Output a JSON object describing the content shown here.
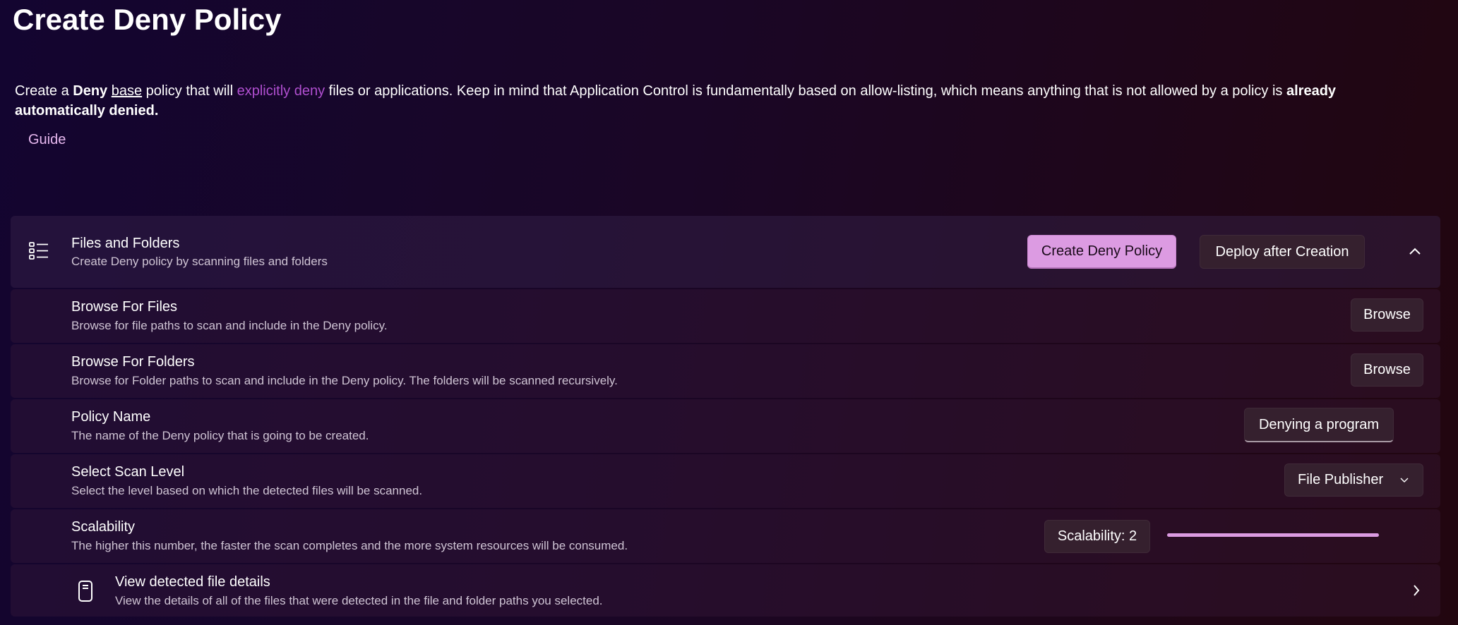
{
  "page": {
    "title": "Create Deny Policy",
    "intro": {
      "p1": "Create a ",
      "deny": "Deny",
      "p2": " ",
      "base": "base",
      "p3": " policy that will ",
      "explicit": "explicitly deny",
      "p4": " files or applications. Keep in mind that Application Control is fundamentally based on allow-listing, which means anything that is not allowed by a policy is ",
      "already": "already automatically denied."
    },
    "guide": "Guide"
  },
  "section": {
    "title": "Files and Folders",
    "subtitle": "Create Deny policy by scanning files and folders",
    "create_label": "Create Deny Policy",
    "deploy_label": "Deploy after Creation",
    "icon": "list-icon",
    "accent": "#dc9be2"
  },
  "rows": [
    {
      "title": "Browse For Files",
      "subtitle": "Browse for file paths to scan and include in the Deny policy.",
      "button": "Browse"
    },
    {
      "title": "Browse For Folders",
      "subtitle": "Browse for Folder paths to scan and include in the Deny policy. The folders will be scanned recursively.",
      "button": "Browse"
    },
    {
      "title": "Policy Name",
      "subtitle": "The name of the Deny policy that is going to be created.",
      "value": "Denying a program"
    },
    {
      "title": "Select Scan Level",
      "subtitle": "Select the level based on which the detected files will be scanned.",
      "selected": "File Publisher"
    },
    {
      "title": "Scalability",
      "subtitle": "The higher this number, the faster the scan completes and the more system resources will be consumed.",
      "badge": "Scalability: 2",
      "slider_fill_percent": 100
    },
    {
      "title": "View detected file details",
      "subtitle": "View the details of all of the files that were detected in the file and folder paths you selected.",
      "icon": "document-icon"
    }
  ]
}
